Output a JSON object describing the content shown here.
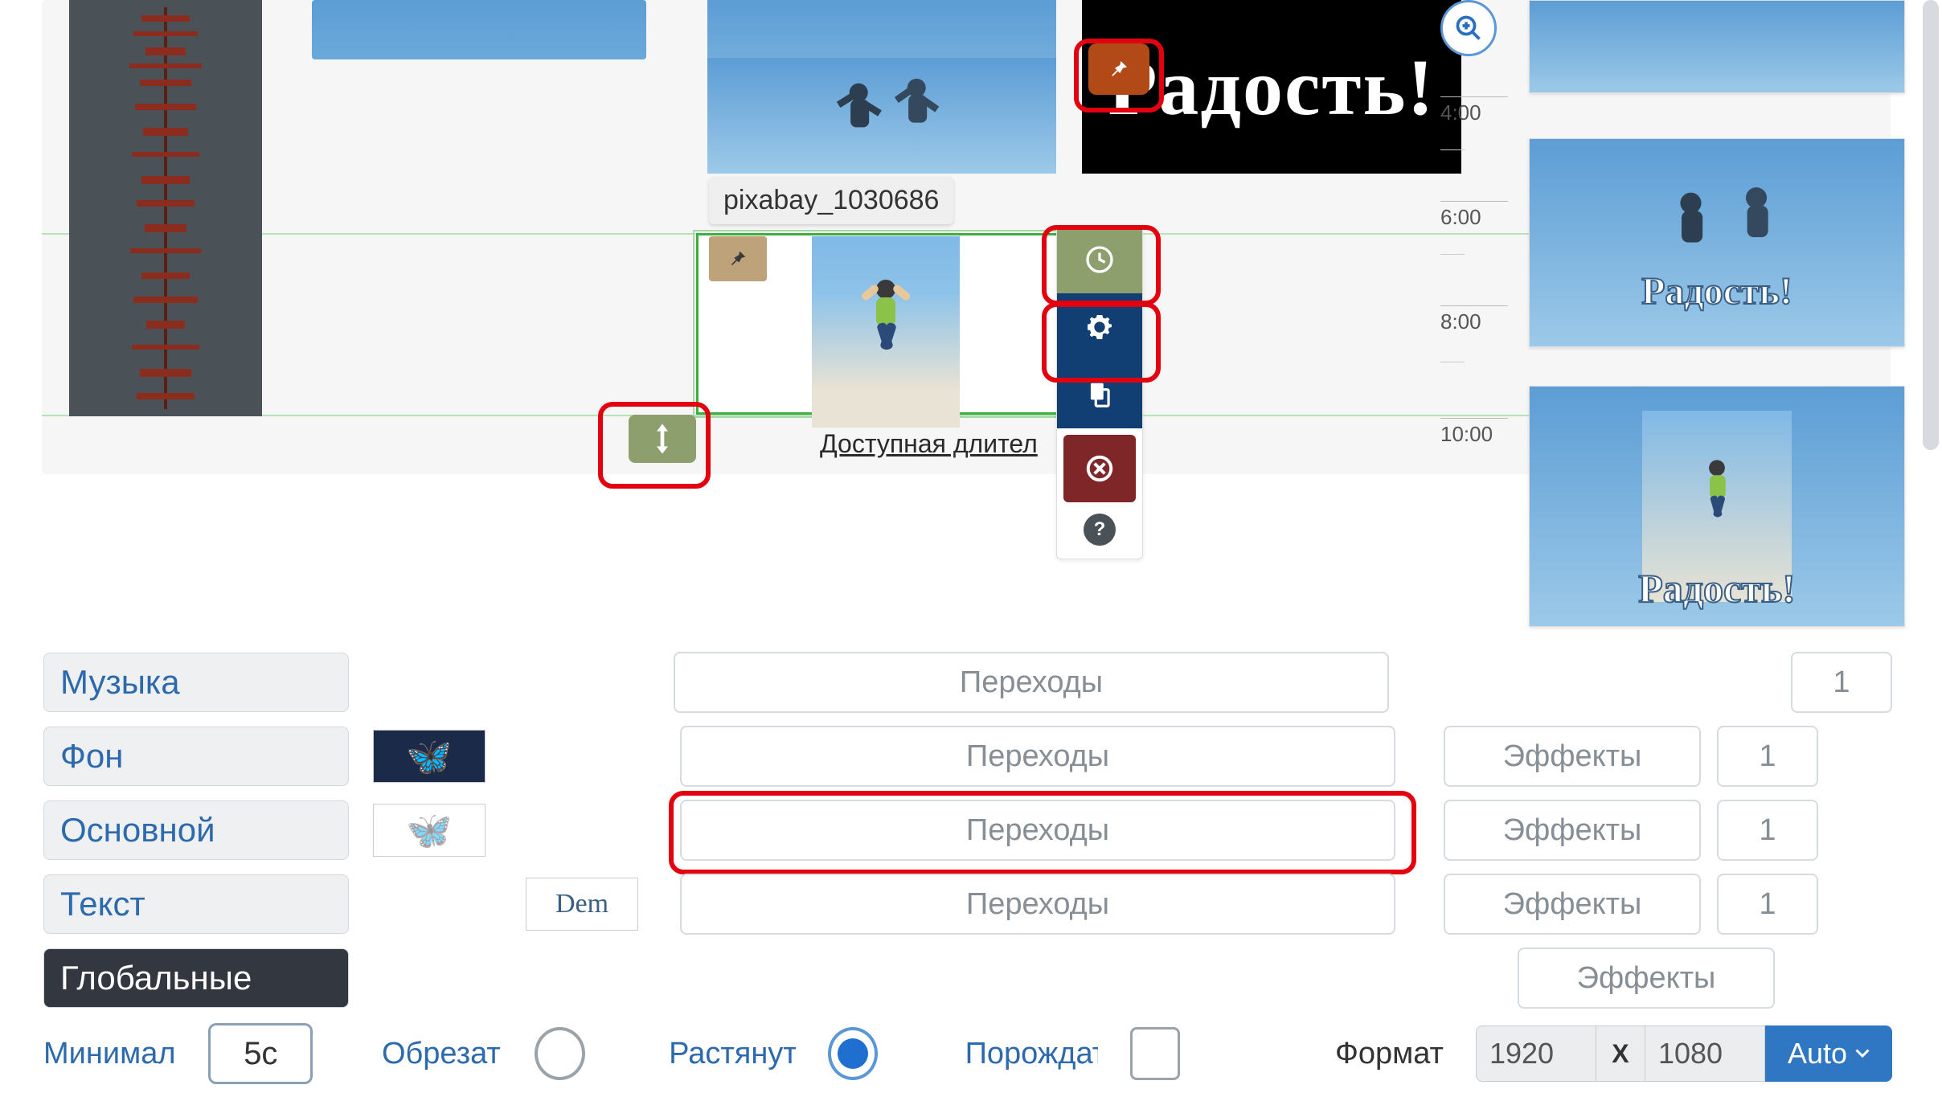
{
  "clips": {
    "tooltip_label": "pixabay_1030686",
    "available_duration_label": "Доступная длител",
    "joy_text": "Радость!",
    "joy_text_outlined": "Радость!",
    "joy_text_outlined_2": "Радость!"
  },
  "ruler": {
    "ticks": [
      "4:00",
      "6:00",
      "8:00",
      "10:00"
    ]
  },
  "toolbar": {
    "time_icon": "clock",
    "settings_icon": "gear",
    "copy_icon": "copy",
    "delete_icon": "delete",
    "help_icon": "?"
  },
  "layers": {
    "music": "Музыка",
    "background": "Фон",
    "main": "Основной",
    "text": "Текст",
    "global": "Глобальные",
    "demo_chip": "Dem"
  },
  "transitions_label": "Переходы",
  "effects_label": "Эффекты",
  "counts": {
    "r1": "1",
    "r2": "1",
    "r3": "1",
    "r4": "1"
  },
  "format": {
    "min_label": "Минималь",
    "min_value": "5с",
    "crop_label": "Обрезать",
    "stretch_label": "Растянуть",
    "spawn_label": "Порождать",
    "format_label": "Формат",
    "width": "1920",
    "x": "X",
    "height": "1080",
    "auto": "Auto"
  },
  "zoom_icon": "zoom-in"
}
